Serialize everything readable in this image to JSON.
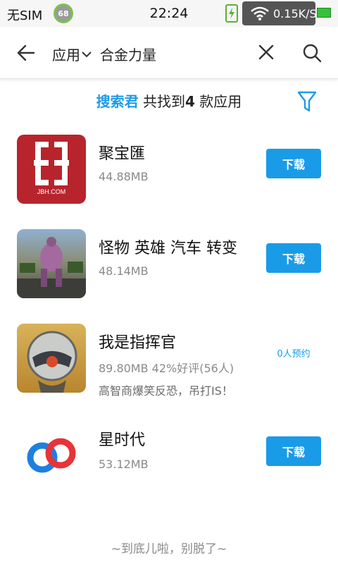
{
  "status_bar": {
    "carrier": "无SIM",
    "badge": "68",
    "time": "22:24",
    "net_speed": "0.15K/S",
    "icons": [
      "notification-count-icon",
      "charging-icon",
      "wifi-icon",
      "battery-icon"
    ]
  },
  "header": {
    "scope_label": "应用",
    "query": "合金力量",
    "icons": [
      "back-arrow-icon",
      "chevron-down-icon",
      "clear-icon",
      "search-icon"
    ]
  },
  "summary": {
    "brand": "搜索君",
    "prefix": " 共找到",
    "count": "4",
    "suffix": " 款应用",
    "icons": [
      "filter-icon"
    ]
  },
  "apps": [
    {
      "name": "聚宝匯",
      "size": "44.88MB",
      "action": "下载",
      "icon_text": "JBH.COM"
    },
    {
      "name": "怪物 英雄 汽车 转变",
      "size": "48.14MB",
      "action": "下载"
    },
    {
      "name": "我是指挥官",
      "meta": "89.80MB  42%好评(56人)",
      "desc": "高智商爆笑反恐，吊打IS！",
      "reserve": "0人预约"
    },
    {
      "name": "星时代",
      "size": "53.12MB",
      "action": "下载"
    }
  ],
  "footer": "~到底儿啦，别脱了~",
  "colors": {
    "accent": "#1a9be8",
    "charge": "#5ab034",
    "jbh_red": "#b8242c"
  }
}
